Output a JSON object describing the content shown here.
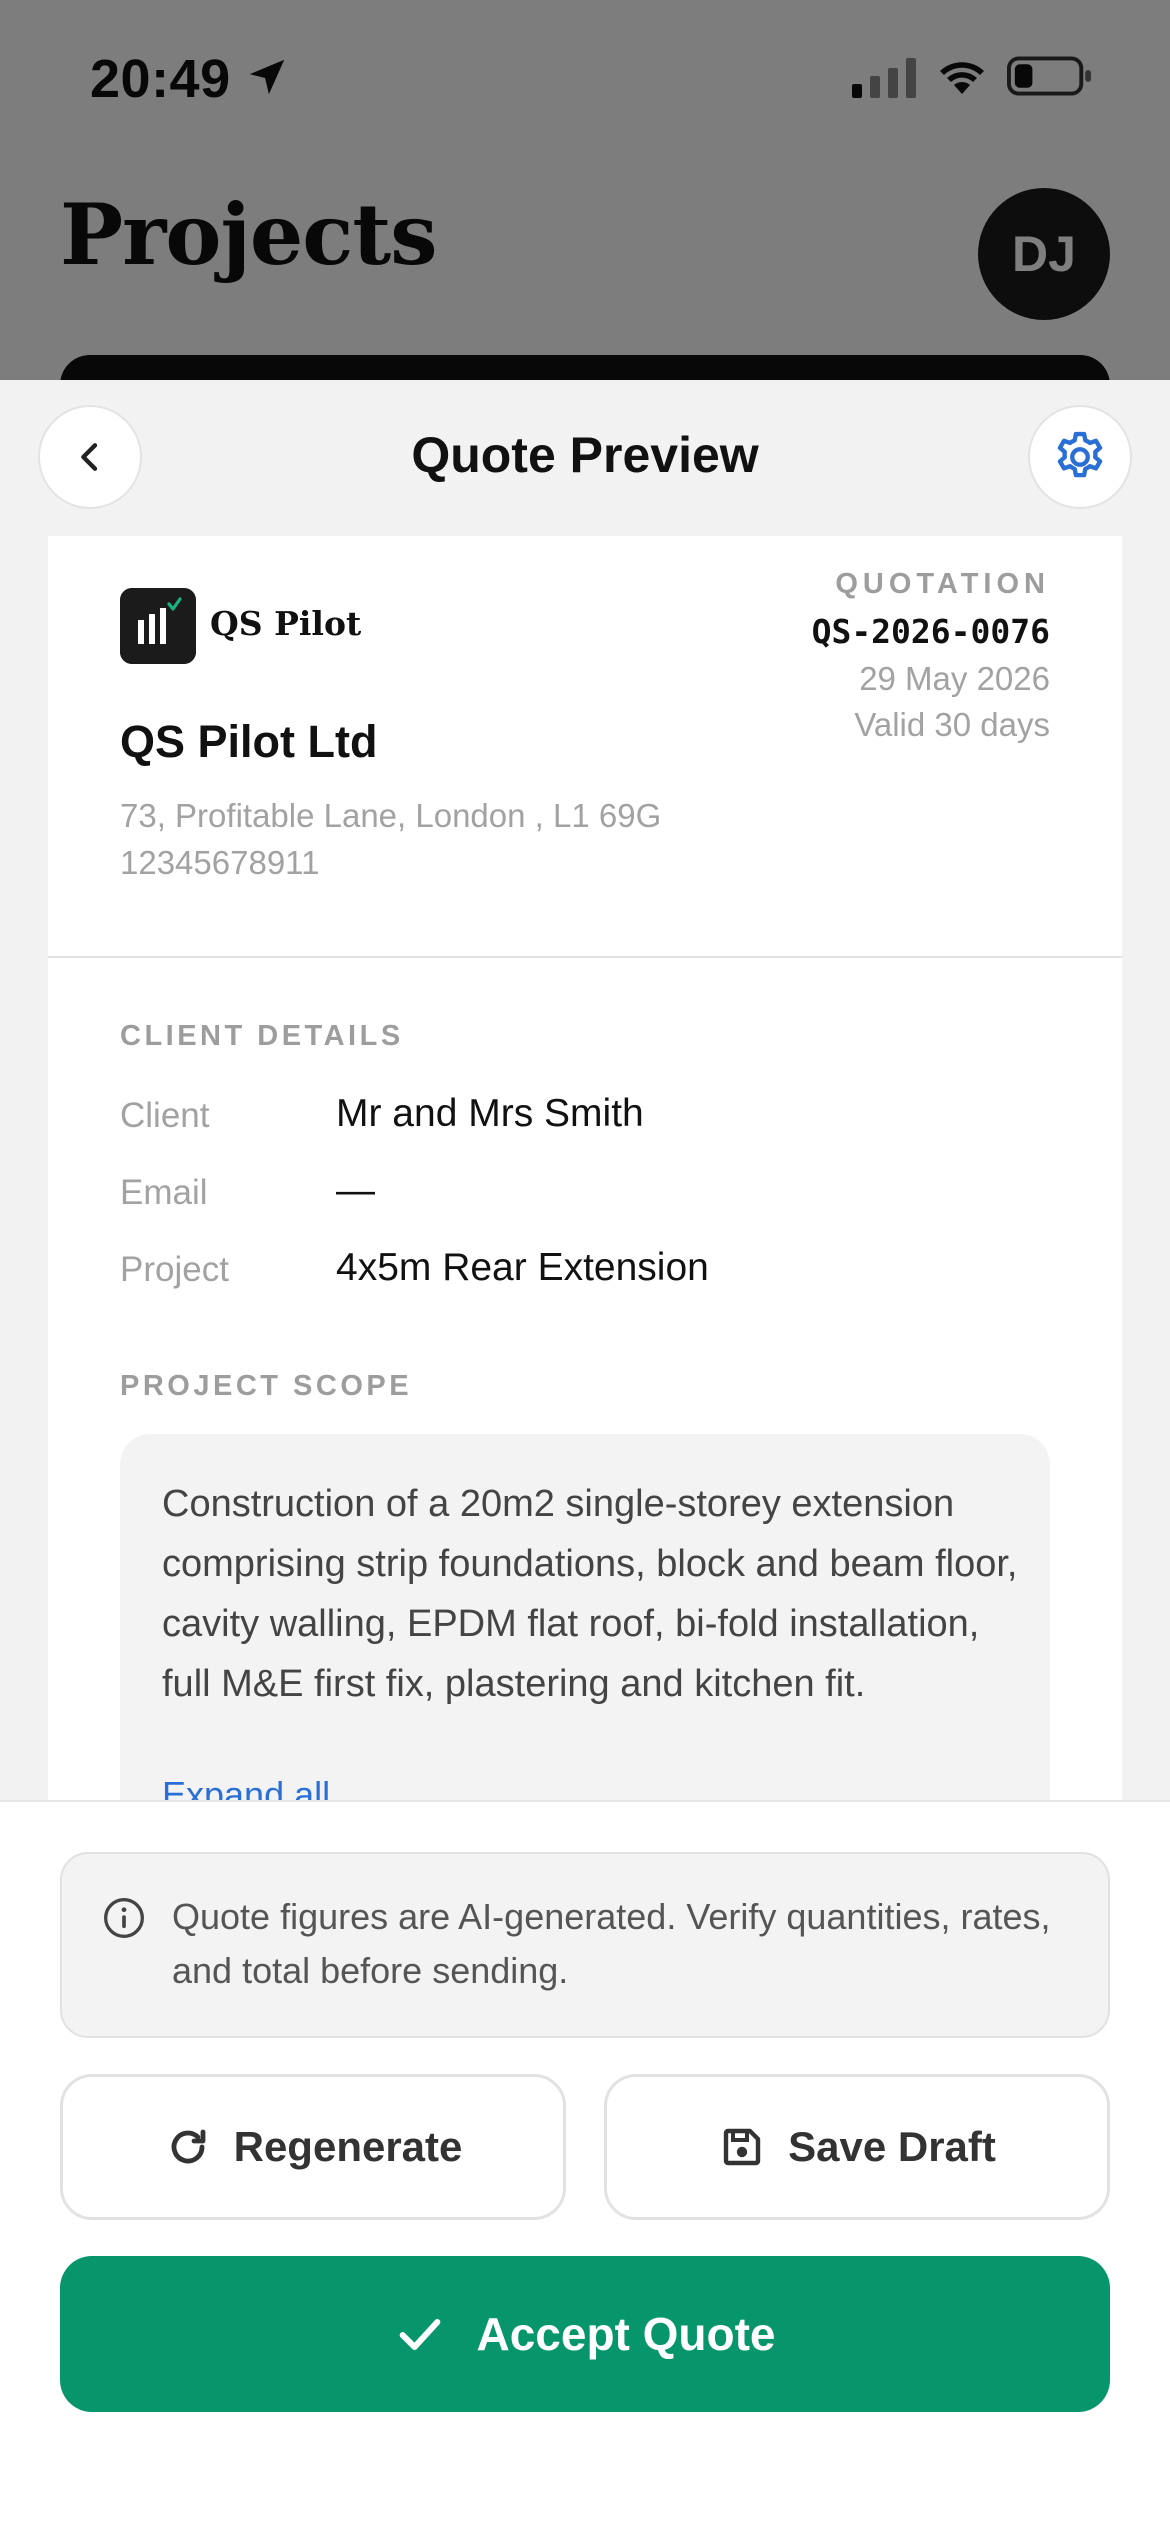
{
  "status_bar": {
    "time": "20:49"
  },
  "background": {
    "title": "Projects",
    "avatar_initials": "DJ"
  },
  "header": {
    "title": "Quote Preview"
  },
  "company": {
    "logo_text": "QS Pilot",
    "name": "QS Pilot Ltd",
    "address": "73, Profitable Lane, London , L1 69G",
    "phone": "12345678911"
  },
  "quote": {
    "label": "QUOTATION",
    "number": "QS-2026-0076",
    "date": "29 May 2026",
    "validity": "Valid 30 days"
  },
  "client_details": {
    "label": "CLIENT DETAILS",
    "rows": [
      {
        "key": "Client",
        "value": "Mr and Mrs Smith"
      },
      {
        "key": "Email",
        "value": "—"
      },
      {
        "key": "Project",
        "value": "4x5m Rear Extension"
      }
    ]
  },
  "scope": {
    "label": "PROJECT SCOPE",
    "text": "Construction of a 20m2 single-storey extension comprising strip foundations, block and beam floor, cavity walling, EPDM flat roof, bi-fold installation, full M&E first fix, plastering and kitchen fit.",
    "expand_label": "Expand all"
  },
  "notice": {
    "text": "Quote figures are AI-generated. Verify quantities, rates, and total before sending."
  },
  "actions": {
    "regenerate_label": "Regenerate",
    "save_draft_label": "Save Draft",
    "accept_label": "Accept Quote"
  },
  "colors": {
    "accent_green": "#07966c",
    "link_blue": "#2a6fd6"
  }
}
